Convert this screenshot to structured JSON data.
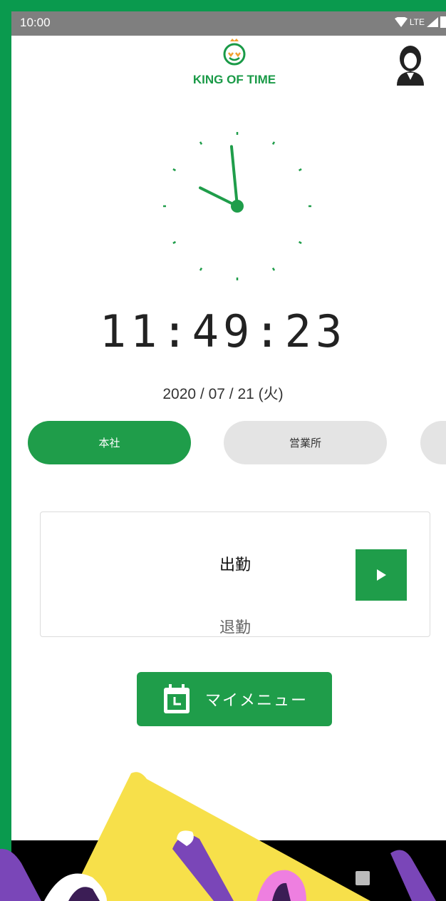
{
  "status_bar": {
    "time": "10:00",
    "network": "LTE"
  },
  "header": {
    "app_name": "KING OF TIME"
  },
  "clock": {
    "hour": 11,
    "minute": 49,
    "second": 23
  },
  "time_display": "11:49:23",
  "date_display": "2020 / 07 / 21 (火)",
  "locations": [
    {
      "label": "本社",
      "active": true
    },
    {
      "label": "営業所",
      "active": false
    }
  ],
  "punch": {
    "clock_in_label": "出勤",
    "clock_out_label": "退勤"
  },
  "my_menu": {
    "label": "マイメニュー"
  },
  "colors": {
    "brand_green": "#1f9d4a",
    "frame_green": "#0a9a4e",
    "overlay_yellow": "#f7e04a",
    "overlay_purple": "#7a46b8"
  }
}
